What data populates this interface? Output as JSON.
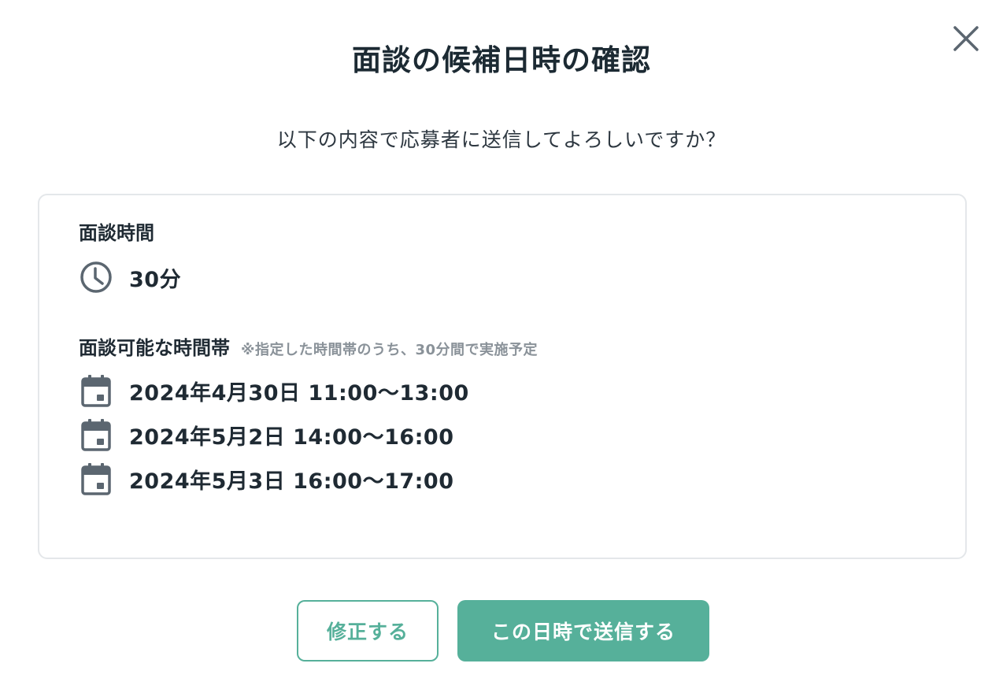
{
  "dialog": {
    "title": "面談の候補日時の確認",
    "subtitle": "以下の内容で応募者に送信してよろしいですか？",
    "close_icon": "close-icon"
  },
  "details": {
    "duration_label": "面談時間",
    "duration_icon": "clock-icon",
    "duration_value": "30分",
    "slots_label": "面談可能な時間帯",
    "slots_note": "※指定した時間帯のうち、30分間で実施予定",
    "slot_icon": "calendar-icon",
    "slots": [
      "2024年4月30日 11:00〜13:00",
      "2024年5月2日 14:00〜16:00",
      "2024年5月3日 16:00〜17:00"
    ]
  },
  "actions": {
    "edit_label": "修正する",
    "send_label": "この日時で送信する"
  },
  "colors": {
    "accent": "#56b09a",
    "text": "#1f2a33",
    "muted": "#8a9299",
    "icon": "#5b6670",
    "border": "#e4e7ea"
  }
}
